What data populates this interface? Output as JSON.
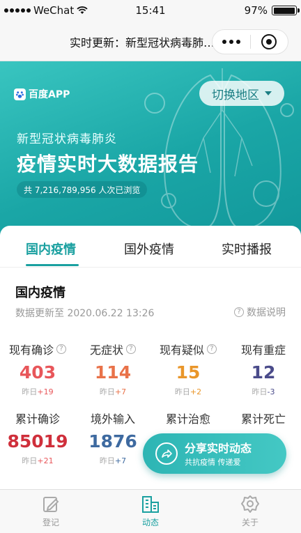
{
  "status_bar": {
    "carrier": "WeChat",
    "time": "15:41",
    "battery": "97%",
    "battery_level": 0.97
  },
  "nav": {
    "title": "实时更新：新型冠状病毒肺…"
  },
  "banner": {
    "brand": "百度APP",
    "region_button": "切换地区",
    "subtitle": "新型冠状病毒肺炎",
    "headline": "疫情实时大数据报告",
    "views": "共 7,216,789,956 人次已浏览"
  },
  "tabs": [
    "国内疫情",
    "国外疫情",
    "实时播报"
  ],
  "section": {
    "title": "国内疫情",
    "update_time": "数据更新至 2020.06.22 13:26",
    "data_note": "数据说明"
  },
  "stats_row1": [
    {
      "label": "现有确诊",
      "has_help": true,
      "value": "403",
      "delta_label": "昨日",
      "delta": "+19",
      "color": "#e8565a",
      "delta_color": "#e8565a"
    },
    {
      "label": "无症状",
      "has_help": true,
      "value": "114",
      "delta_label": "昨日",
      "delta": "+7",
      "color": "#e97249",
      "delta_color": "#e97249"
    },
    {
      "label": "现有疑似",
      "has_help": true,
      "value": "15",
      "delta_label": "昨日",
      "delta": "+2",
      "color": "#e9962a",
      "delta_color": "#e9962a"
    },
    {
      "label": "现有重症",
      "has_help": false,
      "value": "12",
      "delta_label": "昨日",
      "delta": "-3",
      "color": "#4a4b8a",
      "delta_color": "#4a4b8a"
    }
  ],
  "stats_row2": [
    {
      "label": "累计确诊",
      "value": "85019",
      "delta_label": "昨日",
      "delta": "+21",
      "color": "#cf2f3b",
      "delta_color": "#e8565a"
    },
    {
      "label": "境外输入",
      "value": "1876",
      "delta_label": "昨日",
      "delta": "+7",
      "color": "#3e6aa0",
      "delta_color": "#3e6aa0"
    },
    {
      "label": "累计治愈",
      "value": "",
      "delta_label": "",
      "delta": "",
      "color": "#2aa06a",
      "delta_color": "#2aa06a"
    },
    {
      "label": "累计死亡",
      "value": "",
      "delta_label": "",
      "delta": "",
      "color": "#555555",
      "delta_color": "#555555"
    }
  ],
  "share": {
    "title": "分享实时动态",
    "subtitle": "共抗疫情 传递爱"
  },
  "tab_bar": [
    {
      "label": "登记",
      "icon": "register-icon",
      "active": false
    },
    {
      "label": "动态",
      "icon": "building-icon",
      "active": true
    },
    {
      "label": "关于",
      "icon": "about-icon",
      "active": false
    }
  ],
  "colors": {
    "accent": "#1aa0a0",
    "banner": "#1aa6a6"
  }
}
